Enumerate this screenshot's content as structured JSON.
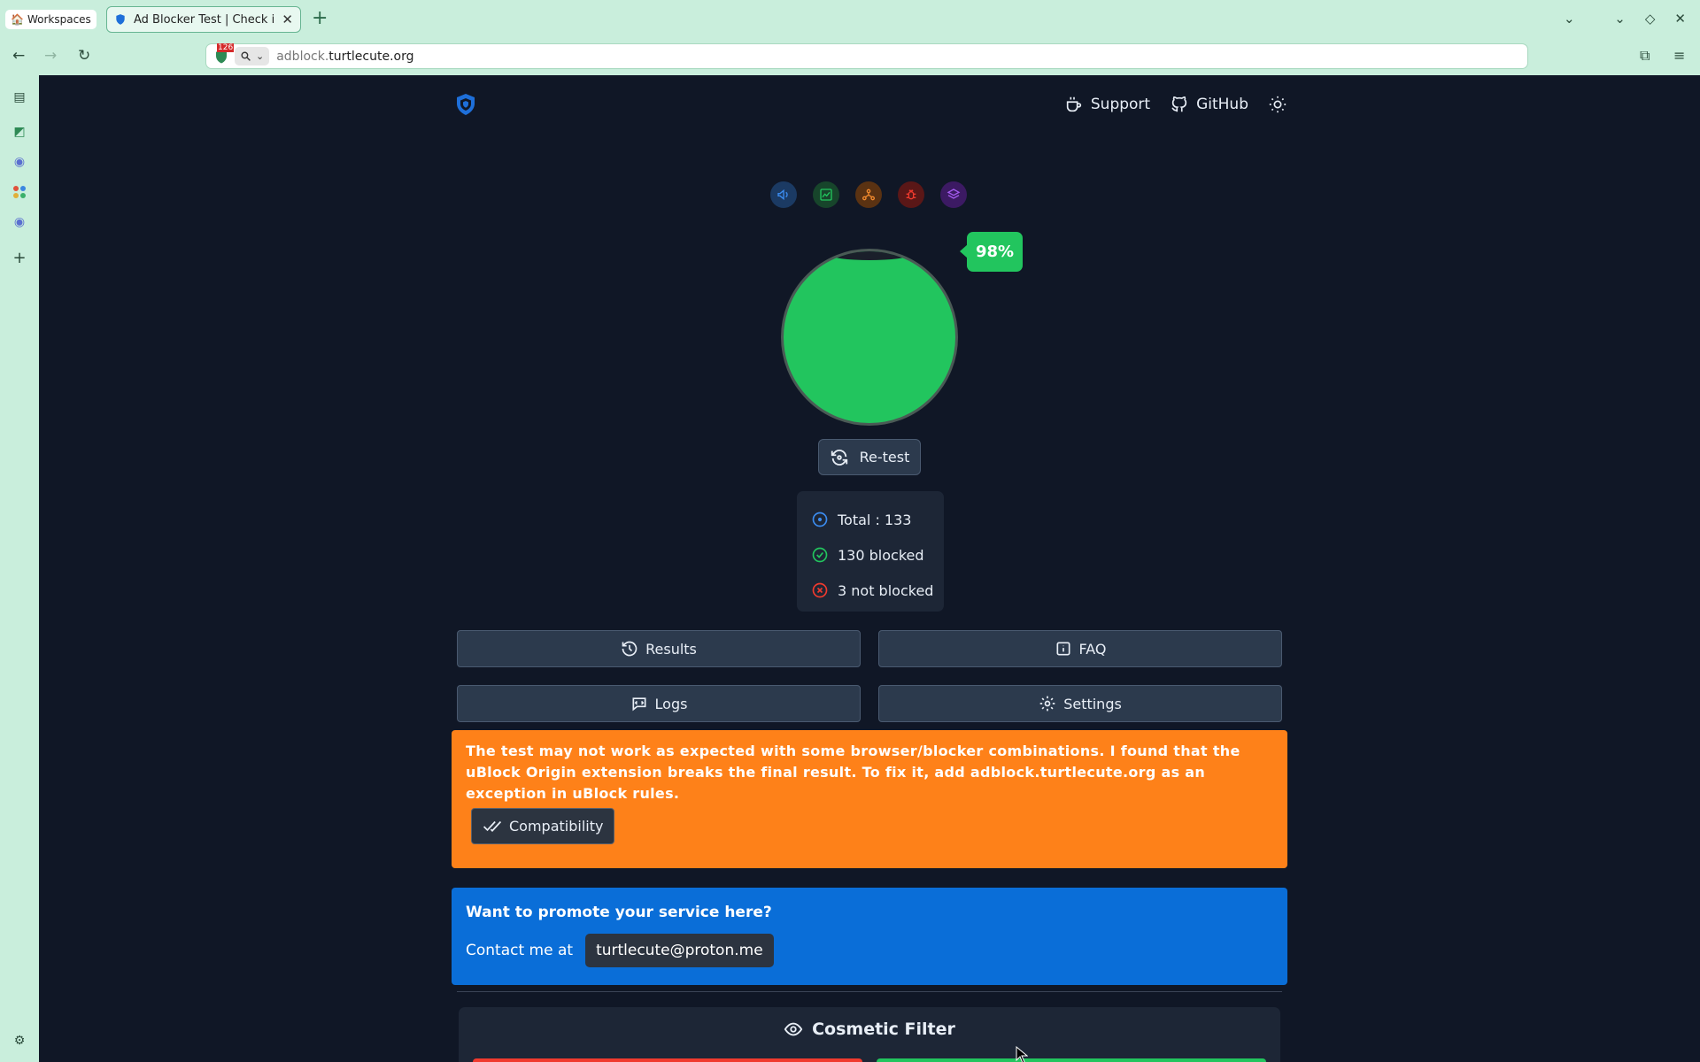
{
  "browser": {
    "workspaces_label": "Workspaces",
    "tab_title": "Ad Blocker Test | Check if Y",
    "url_host": "adblock.",
    "url_domain": "turtlecute.org",
    "badge_count": "126"
  },
  "header": {
    "support_label": "Support",
    "github_label": "GitHub"
  },
  "categories": [
    "ads-icon",
    "analytics-icon",
    "tracking-icon",
    "bug-icon",
    "layers-icon"
  ],
  "score": {
    "percent": "98%",
    "value": 0.98
  },
  "retest_label": "Re-test",
  "stats": {
    "total": "Total : 133",
    "blocked": "130 blocked",
    "not_blocked": "3 not blocked"
  },
  "actions": {
    "results": "Results",
    "faq": "FAQ",
    "logs": "Logs",
    "settings": "Settings"
  },
  "warning": {
    "text": "The test may not work as expected with some browser/blocker combinations. I found that the uBlock Origin extension breaks the final result. To fix it, add adblock.turtlecute.org as an exception in uBlock rules.",
    "button": "Compatibility"
  },
  "promo": {
    "title": "Want to promote your service here?",
    "contact_prefix": "Contact me at",
    "email": "turtlecute@proton.me"
  },
  "cosmetic": {
    "title": "Cosmetic Filter"
  },
  "colors": {
    "page_bg": "#101726",
    "accent_green": "#22c55e",
    "warning_orange": "#fe8119",
    "promo_blue": "#0a6ed8",
    "error_red": "#f03a2e"
  }
}
